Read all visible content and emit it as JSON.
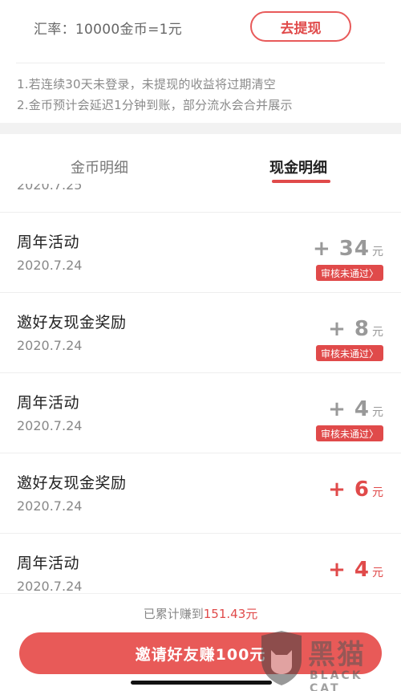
{
  "header": {
    "rate_text": "汇率：10000金币=1元",
    "withdraw_label": "去提现",
    "notes": [
      "1.若连续30天未登录，未提现的收益将过期清空",
      "2.金币预计会延迟1分钟到账，部分流水会合并展示"
    ]
  },
  "tabs": [
    {
      "label": "金币明细",
      "active": false
    },
    {
      "label": "现金明细",
      "active": true
    }
  ],
  "list": {
    "clipped_date": "2020.7.25",
    "items": [
      {
        "title": "周年活动",
        "date": "2020.7.24",
        "amount": "+ 34",
        "unit": "元",
        "status": "审核未通过〉",
        "color": "#999999"
      },
      {
        "title": "邀好友现金奖励",
        "date": "2020.7.24",
        "amount": "+ 8",
        "unit": "元",
        "status": "审核未通过〉",
        "color": "#999999"
      },
      {
        "title": "周年活动",
        "date": "2020.7.24",
        "amount": "+ 4",
        "unit": "元",
        "status": "审核未通过〉",
        "color": "#999999"
      },
      {
        "title": "邀好友现金奖励",
        "date": "2020.7.24",
        "amount": "+ 6",
        "unit": "元",
        "status": "",
        "color": "#e04a4a"
      },
      {
        "title": "周年活动",
        "date": "2020.7.24",
        "amount": "+ 4",
        "unit": "元",
        "status": "",
        "color": "#e04a4a"
      }
    ]
  },
  "footer": {
    "earned_prefix": "已累计赚到",
    "earned_value": "151.43元",
    "invite_label": "邀请好友赚100元"
  },
  "watermark": {
    "text": "黑猫",
    "sub": "BLACK CAT"
  },
  "colors": {
    "accent": "#e04a4a",
    "button": "#e85a58",
    "muted": "#999999"
  }
}
